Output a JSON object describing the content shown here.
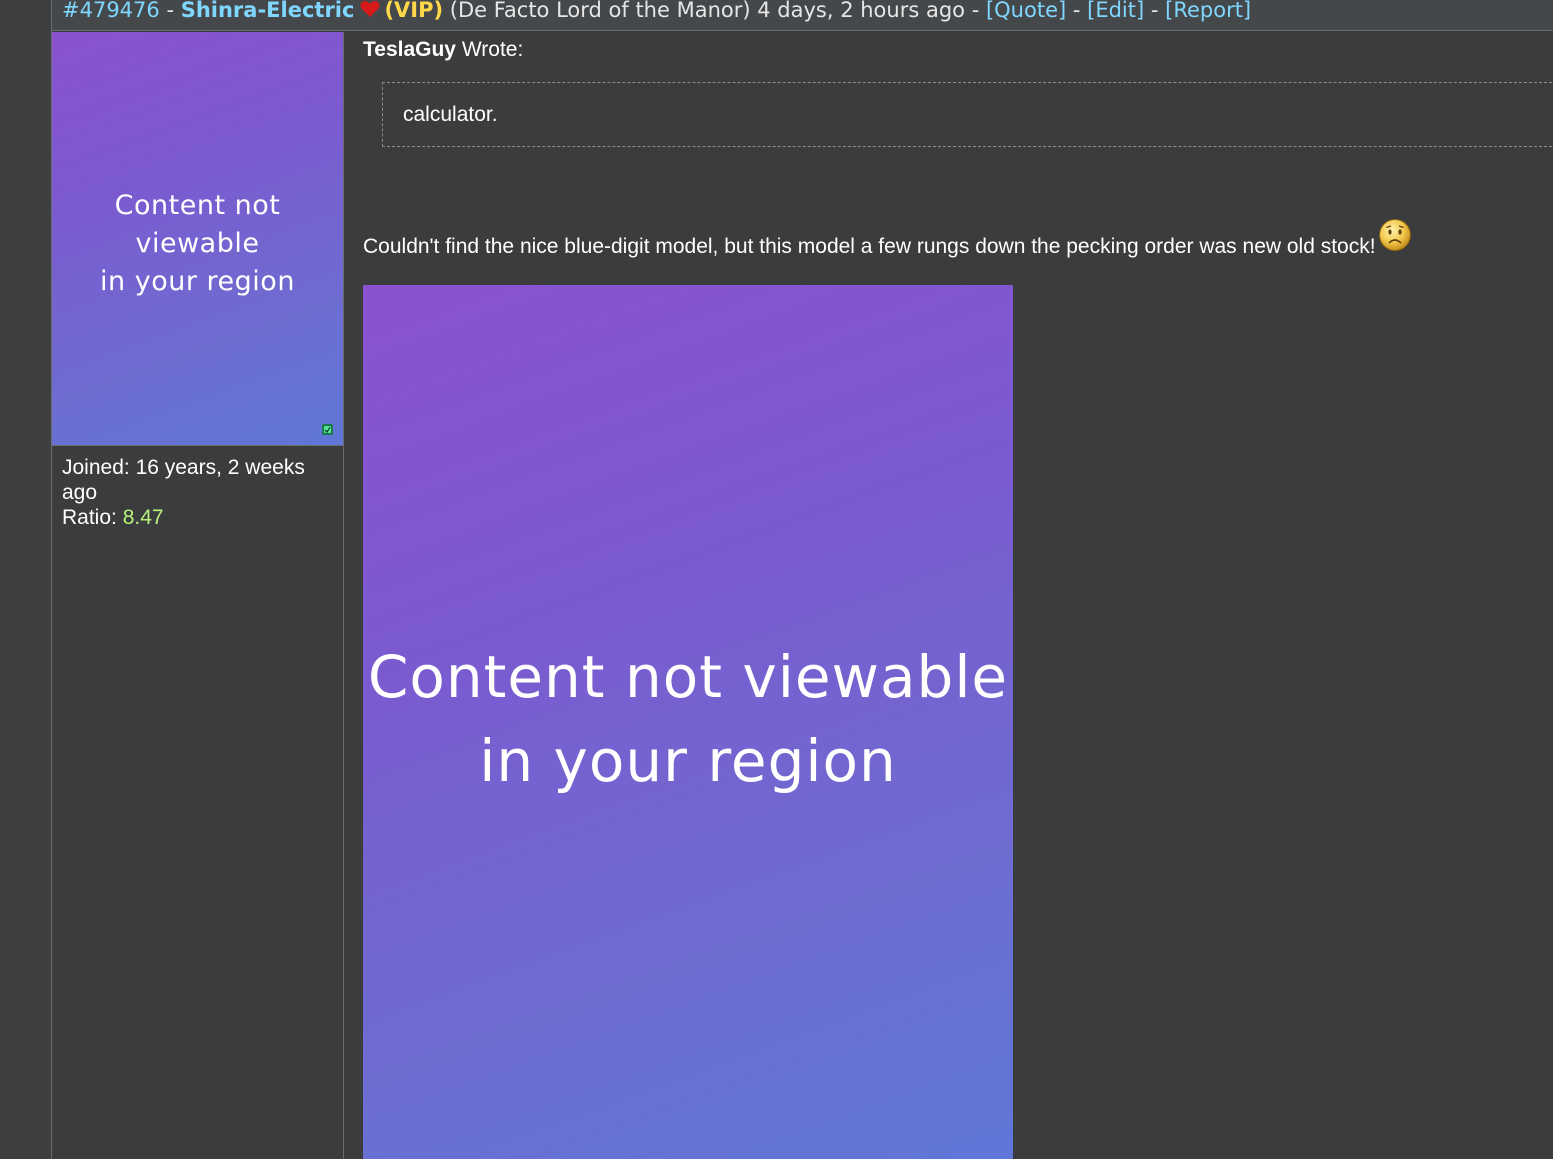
{
  "header": {
    "post_id": "#479476",
    "separator": " - ",
    "username": "Shinra-Electric",
    "badge": "(VIP)",
    "user_title": "(De Facto Lord of the Manor)",
    "timestamp": "4 days, 2 hours ago",
    "quote_link": "[Quote]",
    "edit_link": "[Edit]",
    "report_link": "[Report]",
    "heart_icon": "heart-icon",
    "colors": {
      "link": "#7fd6ff",
      "vip": "#ffd84a"
    }
  },
  "sidebar": {
    "avatar_text_line1": "Content not viewable",
    "avatar_text_line2": "in your region",
    "online_icon": "online-status-icon",
    "joined_label": "Joined:",
    "joined_value": "16 years, 2 weeks ago",
    "ratio_label": "Ratio:",
    "ratio_value": "8.47",
    "ratio_color": "#b9f27a"
  },
  "post": {
    "quote_author": "TeslaGuy",
    "quote_suffix": "Wrote:",
    "quote_text": "calculator.",
    "message": "Couldn't find the nice blue-digit model, but this model a few rungs down the pecking order was new old stock!",
    "smiley": "worried-smiley-icon",
    "image_text_line1": "Content not viewable",
    "image_text_line2": "in your region"
  }
}
